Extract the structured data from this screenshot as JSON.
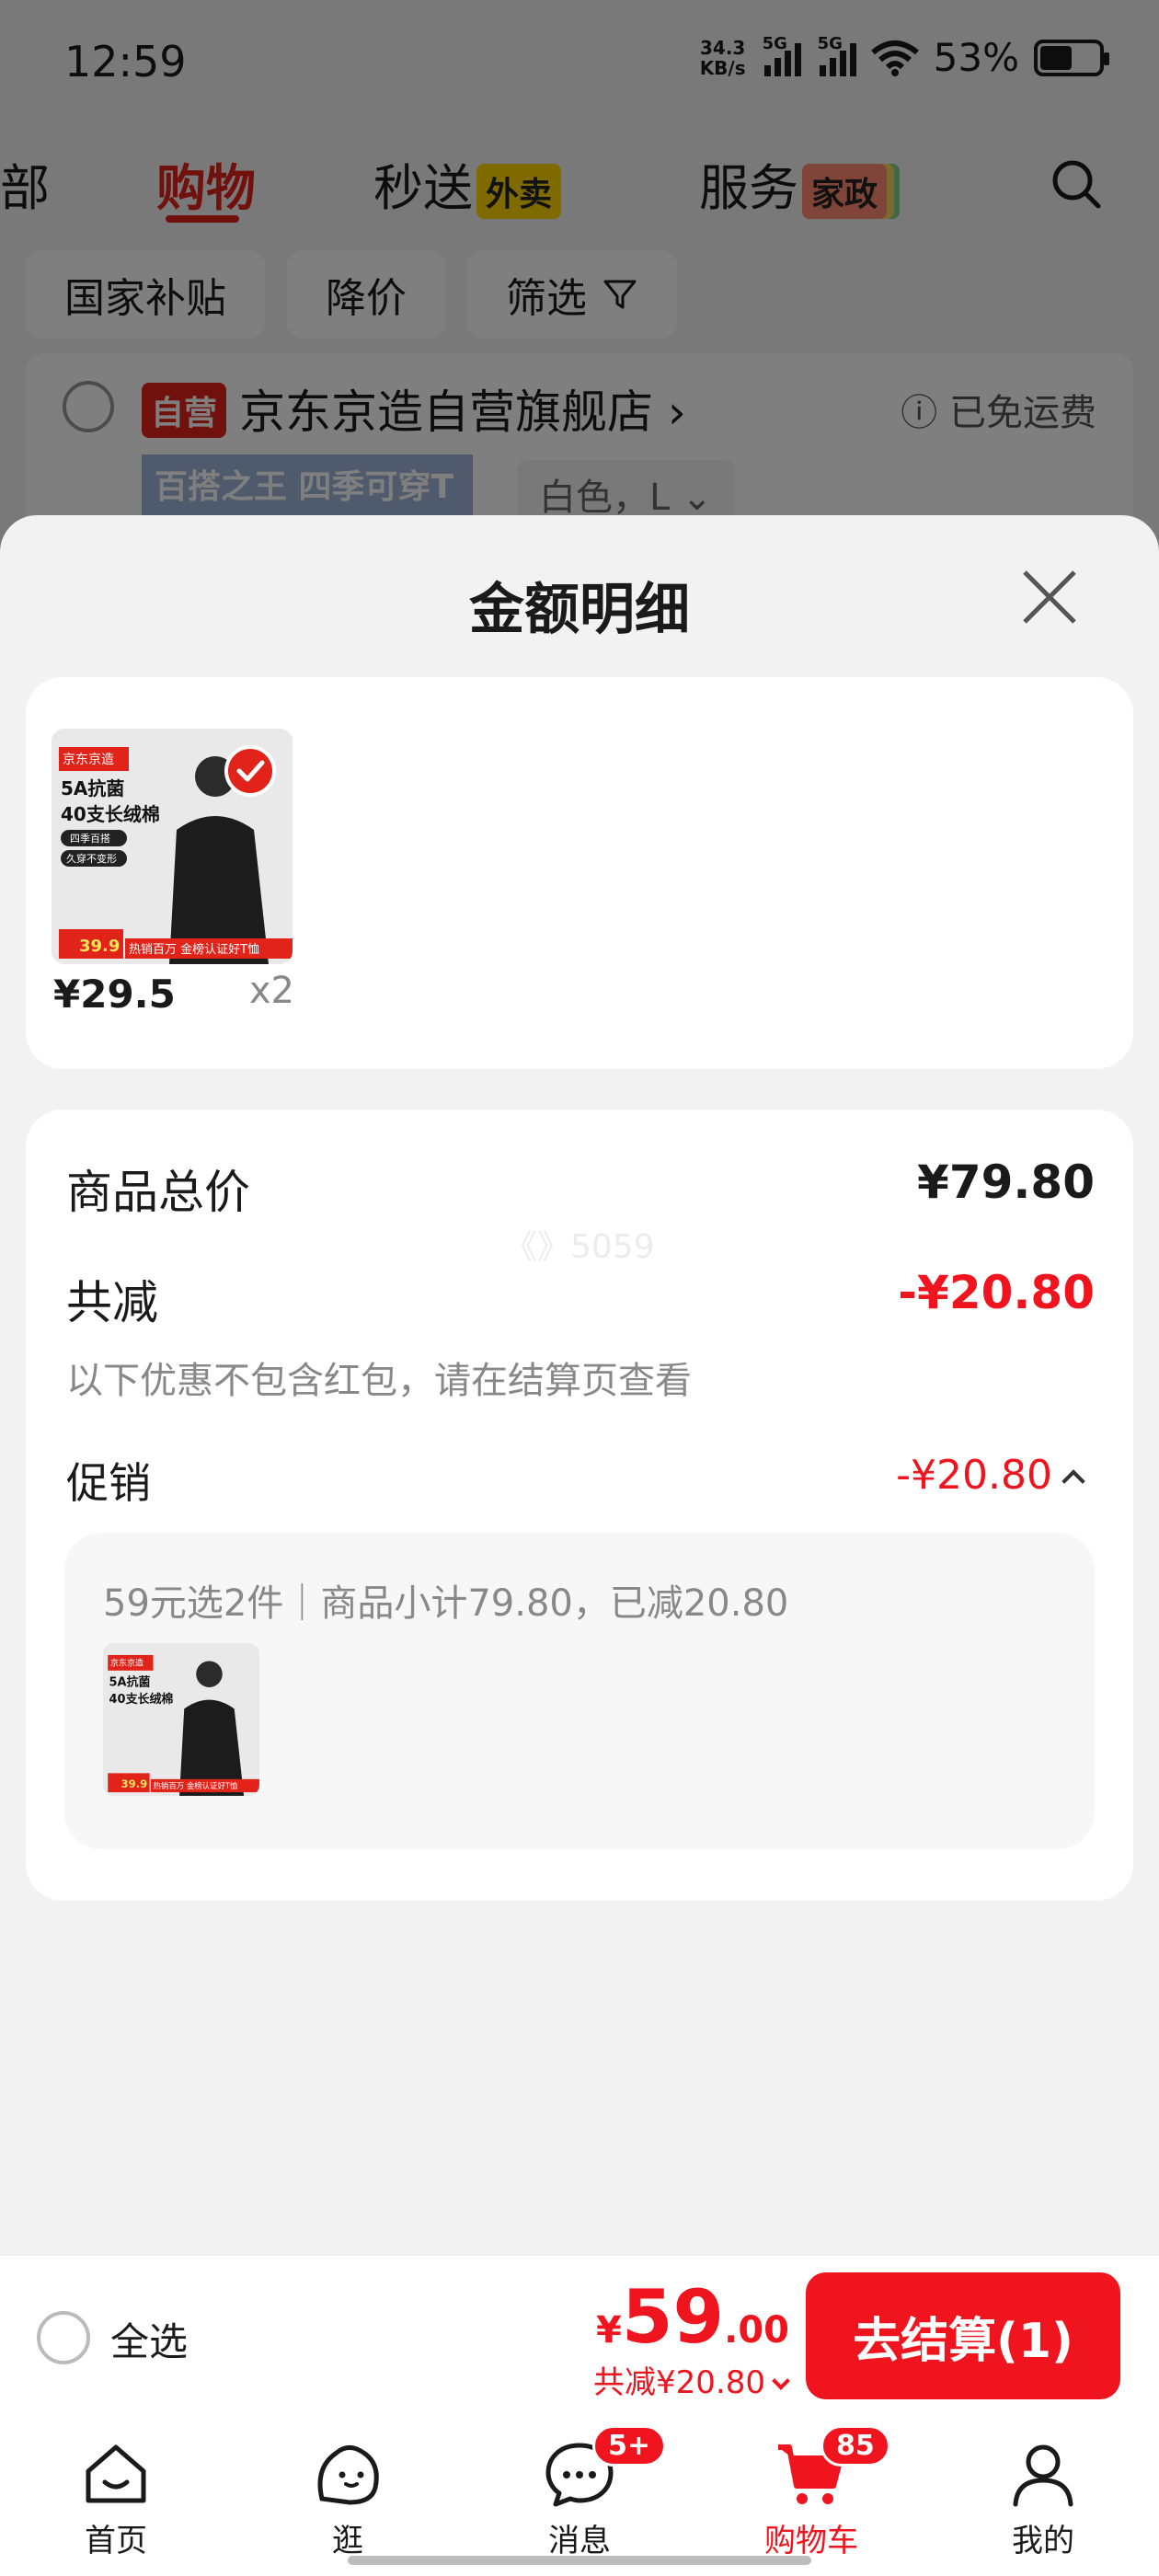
{
  "status_bar": {
    "time": "12:59",
    "net_speed_top": "34.3",
    "net_speed_bottom": "KB/s",
    "sim1": "5G",
    "sim2": "5G",
    "battery": "53%"
  },
  "top_tabs": {
    "partial_left": "部",
    "shopping": "购物",
    "delivery": "秒送",
    "delivery_tag": "外卖",
    "service": "服务",
    "service_tag": "家政"
  },
  "filters": [
    "国家补贴",
    "降价",
    "筛选"
  ],
  "store": {
    "tag": "自营",
    "name": "京东京造自营旗舰店",
    "shipping": "已免运费",
    "thumb_text": "百搭之王 四季可穿T",
    "sku": "白色，L"
  },
  "sheet": {
    "title": "金额明细",
    "items": [
      {
        "price": "¥29.5",
        "qty": "x2",
        "brand": "京东京造",
        "line1": "5A抗菌",
        "line2": "40支长绒棉",
        "tag1": "四季百搭",
        "tag2": "久穿不变形",
        "promo_price": "39.9",
        "ribbon": "热销百万 金榜认证好T恤"
      }
    ],
    "summary": {
      "total_label": "商品总价",
      "total_value": "¥79.80",
      "reduce_label": "共减",
      "reduce_value": "-¥20.80",
      "note": "以下优惠不包含红包，请在结算页查看",
      "promo_label": "促销",
      "promo_value": "-¥20.80",
      "promo_detail": "59元选2件｜商品小计79.80，已减20.80",
      "watermark": "《》5059"
    }
  },
  "checkout": {
    "select_all": "全选",
    "currency": "¥",
    "amount_int": "59",
    "amount_dec": ".00",
    "reduced": "共减¥20.80",
    "button": "去结算(1)"
  },
  "bottom_nav": [
    {
      "label": "首页"
    },
    {
      "label": "逛"
    },
    {
      "label": "消息",
      "badge": "5+"
    },
    {
      "label": "购物车",
      "badge": "85"
    },
    {
      "label": "我的"
    }
  ],
  "colors": {
    "accent": "#f0141e",
    "jd_red": "#e2231a"
  }
}
